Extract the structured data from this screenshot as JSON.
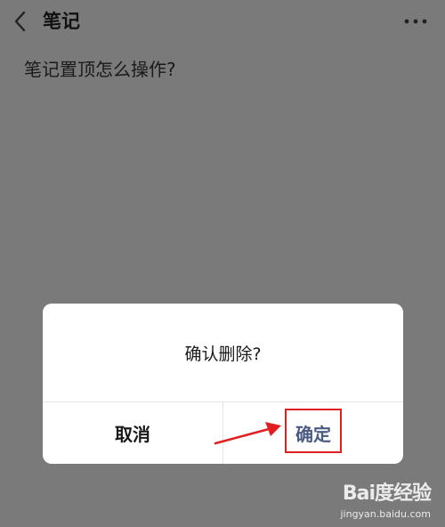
{
  "header": {
    "title": "笔记",
    "back_icon": "chevron-left-icon",
    "more_icon": "more-horizontal-icon"
  },
  "note": {
    "content": "笔记置顶怎么操作?"
  },
  "dialog": {
    "message": "确认删除?",
    "cancel_label": "取消",
    "confirm_label": "确定"
  },
  "annotation": {
    "highlight_color": "#e02020"
  },
  "watermark": {
    "logo_text": "Bai度经验",
    "url": "jingyan.baidu.com"
  },
  "colors": {
    "overlay_bg": "#7a7a7a",
    "dialog_bg": "#ffffff",
    "confirm_text": "#4a5a82"
  }
}
